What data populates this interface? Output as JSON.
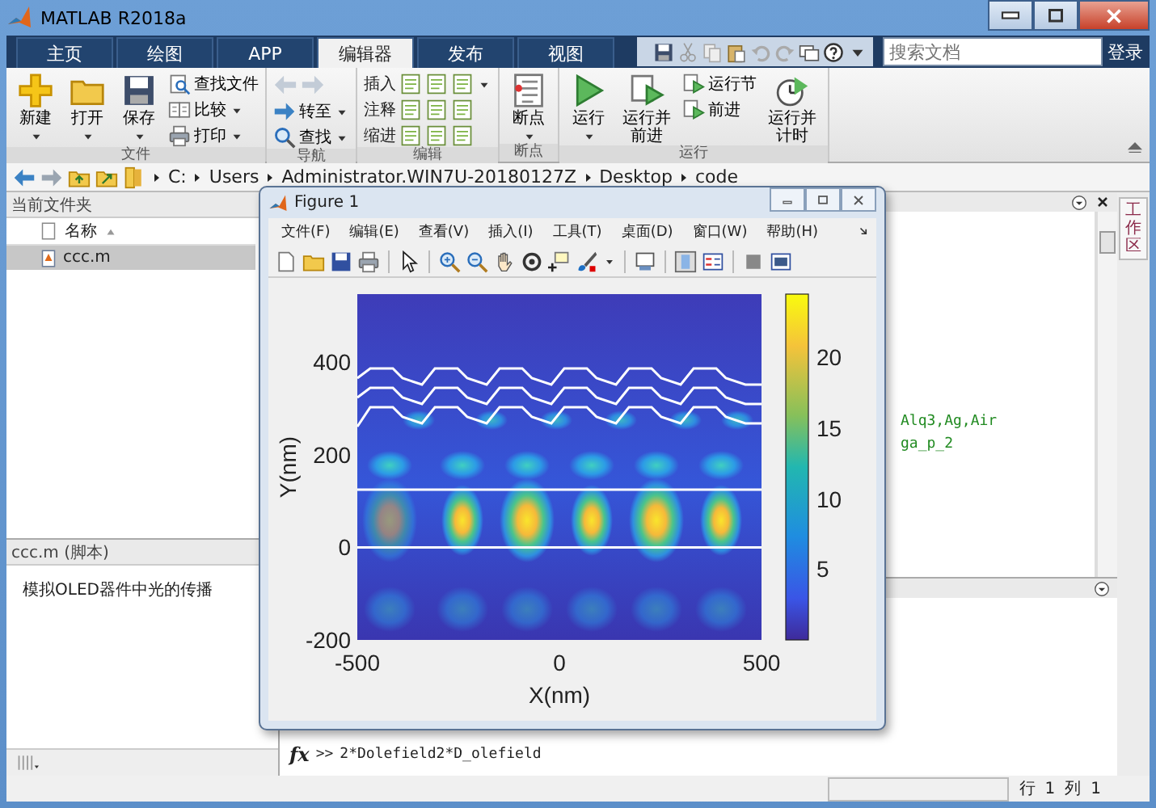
{
  "window": {
    "title": "MATLAB R2018a"
  },
  "ribbon_tabs": [
    {
      "label": "主页",
      "selected": false
    },
    {
      "label": "绘图",
      "selected": false
    },
    {
      "label": "APP",
      "selected": false
    },
    {
      "label": "编辑器",
      "selected": true
    },
    {
      "label": "发布",
      "selected": false
    },
    {
      "label": "视图",
      "selected": false
    }
  ],
  "search": {
    "placeholder": "搜索文档"
  },
  "login": "登录",
  "ribbon": {
    "groups": [
      {
        "label": "文件",
        "items": [
          {
            "kind": "large",
            "label": "新建",
            "dropdown": true
          },
          {
            "kind": "large",
            "label": "打开",
            "dropdown": true
          },
          {
            "kind": "large",
            "label": "保存",
            "dropdown": true
          },
          {
            "kind": "stack",
            "rows": [
              {
                "label": "查找文件",
                "dropdown": false
              },
              {
                "label": "比较",
                "dropdown": true
              },
              {
                "label": "打印",
                "dropdown": true
              }
            ]
          }
        ]
      },
      {
        "label": "导航",
        "items": [
          {
            "kind": "nav",
            "disabled": true,
            "rows": [
              {
                "label": "转至",
                "dropdown": true
              },
              {
                "label": "查找",
                "dropdown": true
              }
            ]
          }
        ]
      },
      {
        "label": "编辑",
        "items": [
          {
            "kind": "grid",
            "rows": [
              {
                "label": "插入",
                "dropdown": true
              },
              {
                "label": "注释",
                "dropdown": false
              },
              {
                "label": "缩进",
                "dropdown": false
              }
            ]
          }
        ]
      },
      {
        "label": "断点",
        "items": [
          {
            "kind": "large",
            "label": "断点",
            "dropdown": true
          }
        ]
      },
      {
        "label": "运行",
        "items": [
          {
            "kind": "large",
            "label": "运行",
            "dropdown": true
          },
          {
            "kind": "large",
            "label": "运行并前进",
            "dropdown": false
          },
          {
            "kind": "stack",
            "rows": [
              {
                "label": "运行节",
                "dropdown": false
              },
              {
                "label": "前进",
                "dropdown": false
              }
            ]
          },
          {
            "kind": "large",
            "label": "运行并计时",
            "dropdown": false
          }
        ]
      }
    ]
  },
  "path": [
    "C:",
    "Users",
    "Administrator.WIN7U-20180127Z",
    "Desktop",
    "code"
  ],
  "current_folder": {
    "title": "当前文件夹",
    "column": "名称",
    "files": [
      {
        "name": "ccc.m",
        "selected": true
      }
    ]
  },
  "details": {
    "title": "ccc.m  (脚本)",
    "text": "模拟OLED器件中光的传播"
  },
  "editor": {
    "lines": [
      "Alq3,Ag,Air",
      "ga_p_2"
    ]
  },
  "workspace_tab": "工作区",
  "command": {
    "fx": "fx",
    "prompt": ">>",
    "text": "2*Dolefield2*D_olefield"
  },
  "status_bar": {
    "row_label": "行",
    "row": "1",
    "col_label": "列",
    "col": "1"
  },
  "figure": {
    "title": "Figure 1",
    "menu": [
      "文件(F)",
      "编辑(E)",
      "查看(V)",
      "插入(I)",
      "工具(T)",
      "桌面(D)",
      "窗口(W)",
      "帮助(H)"
    ],
    "axes": {
      "xticks": [
        "-500",
        "0",
        "500"
      ],
      "yticks": [
        "400",
        "200",
        "0",
        "-200"
      ],
      "xlabel": "X(nm)",
      "ylabel": "Y(nm)",
      "colorbar_ticks": [
        "20",
        "15",
        "10",
        "5"
      ]
    }
  }
}
